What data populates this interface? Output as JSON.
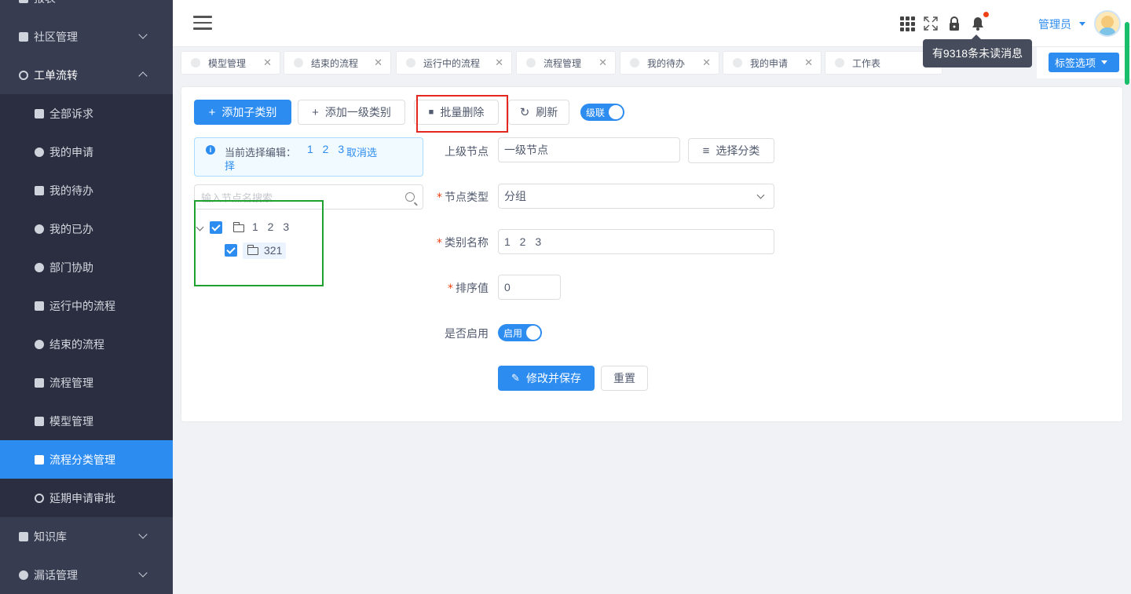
{
  "sidebar": {
    "items": [
      {
        "label": "报表"
      },
      {
        "label": "社区管理"
      },
      {
        "label": "工单流转"
      },
      {
        "label": "全部诉求"
      },
      {
        "label": "我的申请"
      },
      {
        "label": "我的待办"
      },
      {
        "label": "我的已办"
      },
      {
        "label": "部门协助"
      },
      {
        "label": "运行中的流程"
      },
      {
        "label": "结束的流程"
      },
      {
        "label": "流程管理"
      },
      {
        "label": "模型管理"
      },
      {
        "label": "流程分类管理"
      },
      {
        "label": "延期申请审批"
      },
      {
        "label": "知识库"
      },
      {
        "label": "漏话管理"
      }
    ]
  },
  "header": {
    "user_name": "管理员",
    "tooltip": "有9318条未读消息"
  },
  "tags": [
    {
      "label": "模型管理"
    },
    {
      "label": "结束的流程"
    },
    {
      "label": "运行中的流程"
    },
    {
      "label": "流程管理"
    },
    {
      "label": "我的待办"
    },
    {
      "label": "我的申请"
    },
    {
      "label": "工作表"
    }
  ],
  "tag_options_label": "标签选项",
  "toolbar": {
    "add_child": "添加子类别",
    "add_top": "添加一级类别",
    "batch_delete": "批量删除",
    "refresh": "刷新",
    "cascade": "级联"
  },
  "alert": {
    "text": "当前选择编辑：",
    "value": "1 2 3",
    "cancel_a": "取消选",
    "cancel_b": "择"
  },
  "search": {
    "placeholder": "输入节点名搜索"
  },
  "tree": {
    "root": "1 2 3",
    "child": "321"
  },
  "form": {
    "parent_label": "上级节点",
    "parent_value": "一级节点",
    "choose_category": "选择分类",
    "type_label": "节点类型",
    "type_value": "分组",
    "name_label": "类别名称",
    "name_value": "1 2 3",
    "sort_label": "排序值",
    "sort_value": "0",
    "enabled_label": "是否启用",
    "enabled_switch": "启用",
    "required_mark": "*",
    "save": "修改并保存",
    "reset": "重置"
  },
  "colors": {
    "primary": "#2d8cf0",
    "sidebar": "#2f3447",
    "highlight_red": "#e4281f",
    "highlight_green": "#1fa12f"
  }
}
